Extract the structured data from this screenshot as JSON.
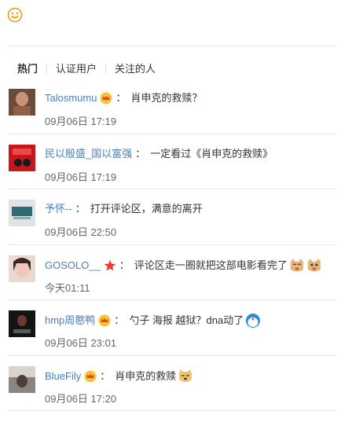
{
  "tabs": [
    {
      "label": "热门",
      "active": true
    },
    {
      "label": "认证用户",
      "active": false
    },
    {
      "label": "关注的人",
      "active": false
    }
  ],
  "comments": [
    {
      "user": "Talosmumu",
      "badge": "crown-icon",
      "text": "肖申克的救赎？",
      "time": "09月06日 17:19"
    },
    {
      "user": "民以殷盛_国以富强",
      "badge": "",
      "text": "一定看过《肖申克的救赎》",
      "time": "09月06日 17:19"
    },
    {
      "user": "予怀--",
      "badge": "",
      "text": "打开评论区，满意的离开",
      "time": "09月06日 22:50"
    },
    {
      "user": "GOSOLO__",
      "badge": "star-icon",
      "text": "评论区走一圈就把这部电影看完了",
      "time": "今天01:11"
    },
    {
      "user": "hmp周憨鸭",
      "badge": "crown-icon",
      "text": "勺子 海报 越狱？dna动了",
      "time": "09月06日 23:01"
    },
    {
      "user": "BlueFily",
      "badge": "crown-icon",
      "text": "肖申克的救赎",
      "time": "09月06日 17:20"
    }
  ],
  "colors": {
    "link": "#4a7fbd",
    "accent": "#f39c12"
  }
}
